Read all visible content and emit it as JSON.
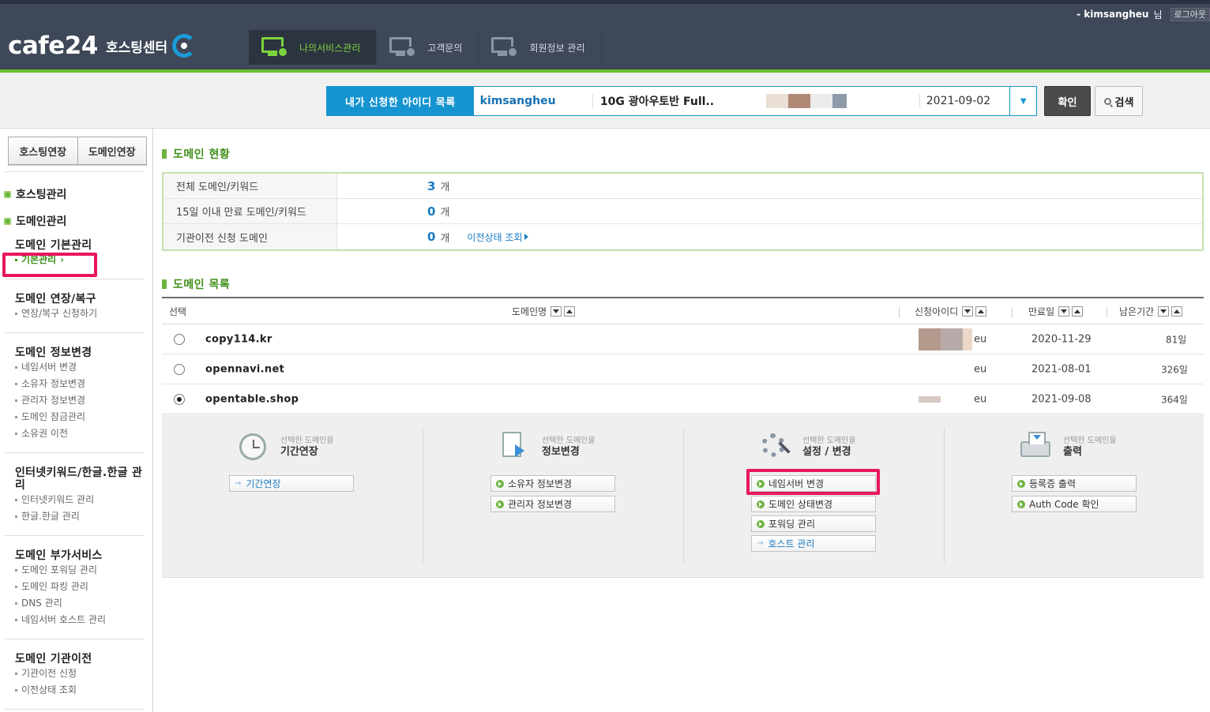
{
  "header": {
    "username": "kimsangheu",
    "user_suffix": "님",
    "logout_label": "로그아웃",
    "brand": "cafe24",
    "brand_sub": "호스팅센터",
    "nav": [
      {
        "label": "나의서비스관리",
        "icon": "monitor-gear-icon"
      },
      {
        "label": "고객문의",
        "icon": "monitor-phone-icon"
      },
      {
        "label": "회원정보 관리",
        "icon": "monitor-user-icon"
      }
    ]
  },
  "id_selector": {
    "label": "내가 신청한 아이디 목록",
    "user_id": "kimsangheu",
    "plan": "10G 광아우토반 Full..",
    "date": "2021-09-02",
    "confirm_label": "확인",
    "search_label": "검색"
  },
  "sidebar": {
    "tabs": [
      "호스팅연장",
      "도메인연장"
    ],
    "top_items": [
      "호스팅관리",
      "도메인관리"
    ],
    "groups": [
      {
        "title": "도메인 기본관리",
        "items": [
          "기본관리"
        ]
      },
      {
        "title": "도메인 연장/복구",
        "items": [
          "연장/복구 신청하기"
        ]
      },
      {
        "title": "도메인 정보변경",
        "items": [
          "네임서버 변경",
          "소유자 정보변경",
          "관리자 정보변경",
          "도메인 잠금관리",
          "소유권 이전"
        ]
      },
      {
        "title": "인터넷키워드/한글.한글 관리",
        "items": [
          "인터넷키워드 관리",
          "한글.한글 관리"
        ]
      },
      {
        "title": "도메인 부가서비스",
        "items": [
          "도메인 포워딩 관리",
          "도메인 파킹 관리",
          "DNS 관리",
          "네임서버 호스트 관리"
        ]
      },
      {
        "title": "도메인 기관이전",
        "items": [
          "기관이전 신청",
          "이전상태 조회"
        ]
      }
    ]
  },
  "status": {
    "title": "도메인 현황",
    "rows": [
      {
        "label": "전체 도메인/키워드",
        "value": "3",
        "unit": "개"
      },
      {
        "label": "15일 이내 만료 도메인/키워드",
        "value": "0",
        "unit": "개"
      },
      {
        "label": "기관이전 신청 도메인",
        "value": "0",
        "unit": "개",
        "link": "이전상태 조회"
      }
    ]
  },
  "domain_list": {
    "title": "도메인 목록",
    "columns": {
      "select": "선택",
      "name": "도메인명",
      "applicant": "신청아이디",
      "expiry": "만료일",
      "remaining": "남은기간"
    },
    "rows": [
      {
        "name": "copy114.kr",
        "applicant_suffix": "eu",
        "expiry": "2020-11-29",
        "remaining": "81일",
        "selected": false
      },
      {
        "name": "opennavi.net",
        "applicant_suffix": "eu",
        "expiry": "2021-08-01",
        "remaining": "326일",
        "selected": false
      },
      {
        "name": "opentable.shop",
        "applicant_suffix": "eu",
        "expiry": "2021-09-08",
        "remaining": "364일",
        "selected": true
      }
    ]
  },
  "actions": [
    {
      "sub": "선택한 도메인을",
      "main": "기간연장",
      "icon": "clock-icon",
      "buttons": [
        {
          "label": "기간연장",
          "style": "blue"
        }
      ]
    },
    {
      "sub": "선택한 도메인을",
      "main": "정보변경",
      "icon": "document-arrow-icon",
      "buttons": [
        {
          "label": "소유자 정보변경",
          "style": "green"
        },
        {
          "label": "관리자 정보변경",
          "style": "green"
        }
      ]
    },
    {
      "sub": "선택한 도메인을",
      "main": "설정 / 변경",
      "icon": "gear-wrench-icon",
      "buttons": [
        {
          "label": "네임서버 변경",
          "style": "green"
        },
        {
          "label": "도메인 상태변경",
          "style": "green"
        },
        {
          "label": "포워딩 관리",
          "style": "green"
        },
        {
          "label": "호스트 관리",
          "style": "blue"
        }
      ]
    },
    {
      "sub": "선택한 도메인을",
      "main": "출력",
      "icon": "printer-icon",
      "buttons": [
        {
          "label": "등록증 출력",
          "style": "green"
        },
        {
          "label": "Auth Code 확인",
          "style": "green"
        }
      ]
    }
  ],
  "colors": {
    "accent_green": "#6cb33f",
    "accent_blue": "#1694d0",
    "highlight": "#e8165d",
    "topbar": "#3e4858"
  }
}
